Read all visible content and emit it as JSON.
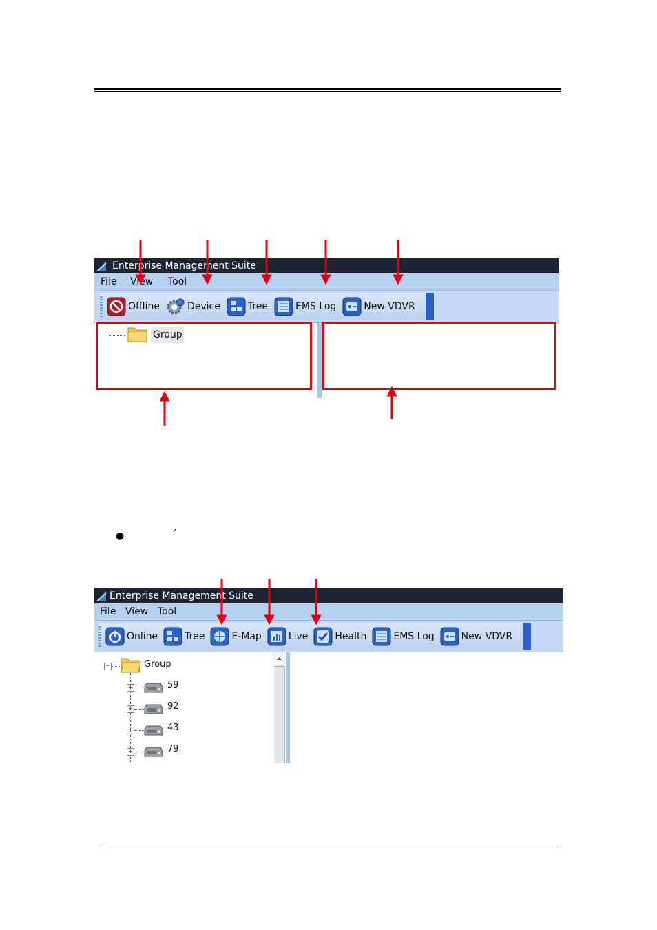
{
  "page": {
    "bullet": "●",
    "apostrophe": "’"
  },
  "shot1": {
    "title": "Enterprise Management Suite",
    "menu": [
      "File",
      "View",
      "Tool"
    ],
    "toolbar": [
      {
        "label": "Offline",
        "icon": "offline-icon"
      },
      {
        "label": "Device",
        "icon": "device-gear-icon"
      },
      {
        "label": "Tree",
        "icon": "tree-icon"
      },
      {
        "label": "EMS Log",
        "icon": "ems-log-icon"
      },
      {
        "label": "New VDVR",
        "icon": "new-vdvr-icon"
      }
    ],
    "tree_root": "Group"
  },
  "shot2": {
    "title": "Enterprise Management Suite",
    "menu": [
      "File",
      "View",
      "Tool"
    ],
    "toolbar": [
      {
        "label": "Online",
        "icon": "online-icon"
      },
      {
        "label": "Tree",
        "icon": "tree-icon"
      },
      {
        "label": "E-Map",
        "icon": "emap-icon"
      },
      {
        "label": "Live",
        "icon": "live-icon"
      },
      {
        "label": "Health",
        "icon": "health-icon"
      },
      {
        "label": "EMS Log",
        "icon": "ems-log-icon"
      },
      {
        "label": "New VDVR",
        "icon": "new-vdvr-icon"
      }
    ],
    "tree_root": "Group",
    "devices": [
      "59",
      "92",
      "43",
      "79"
    ]
  },
  "colors": {
    "annotation_red": "#e00010",
    "titlebar": "#1b2430",
    "menubar": "#b7cff0",
    "toolbar_accent": "#2d5fc0"
  }
}
